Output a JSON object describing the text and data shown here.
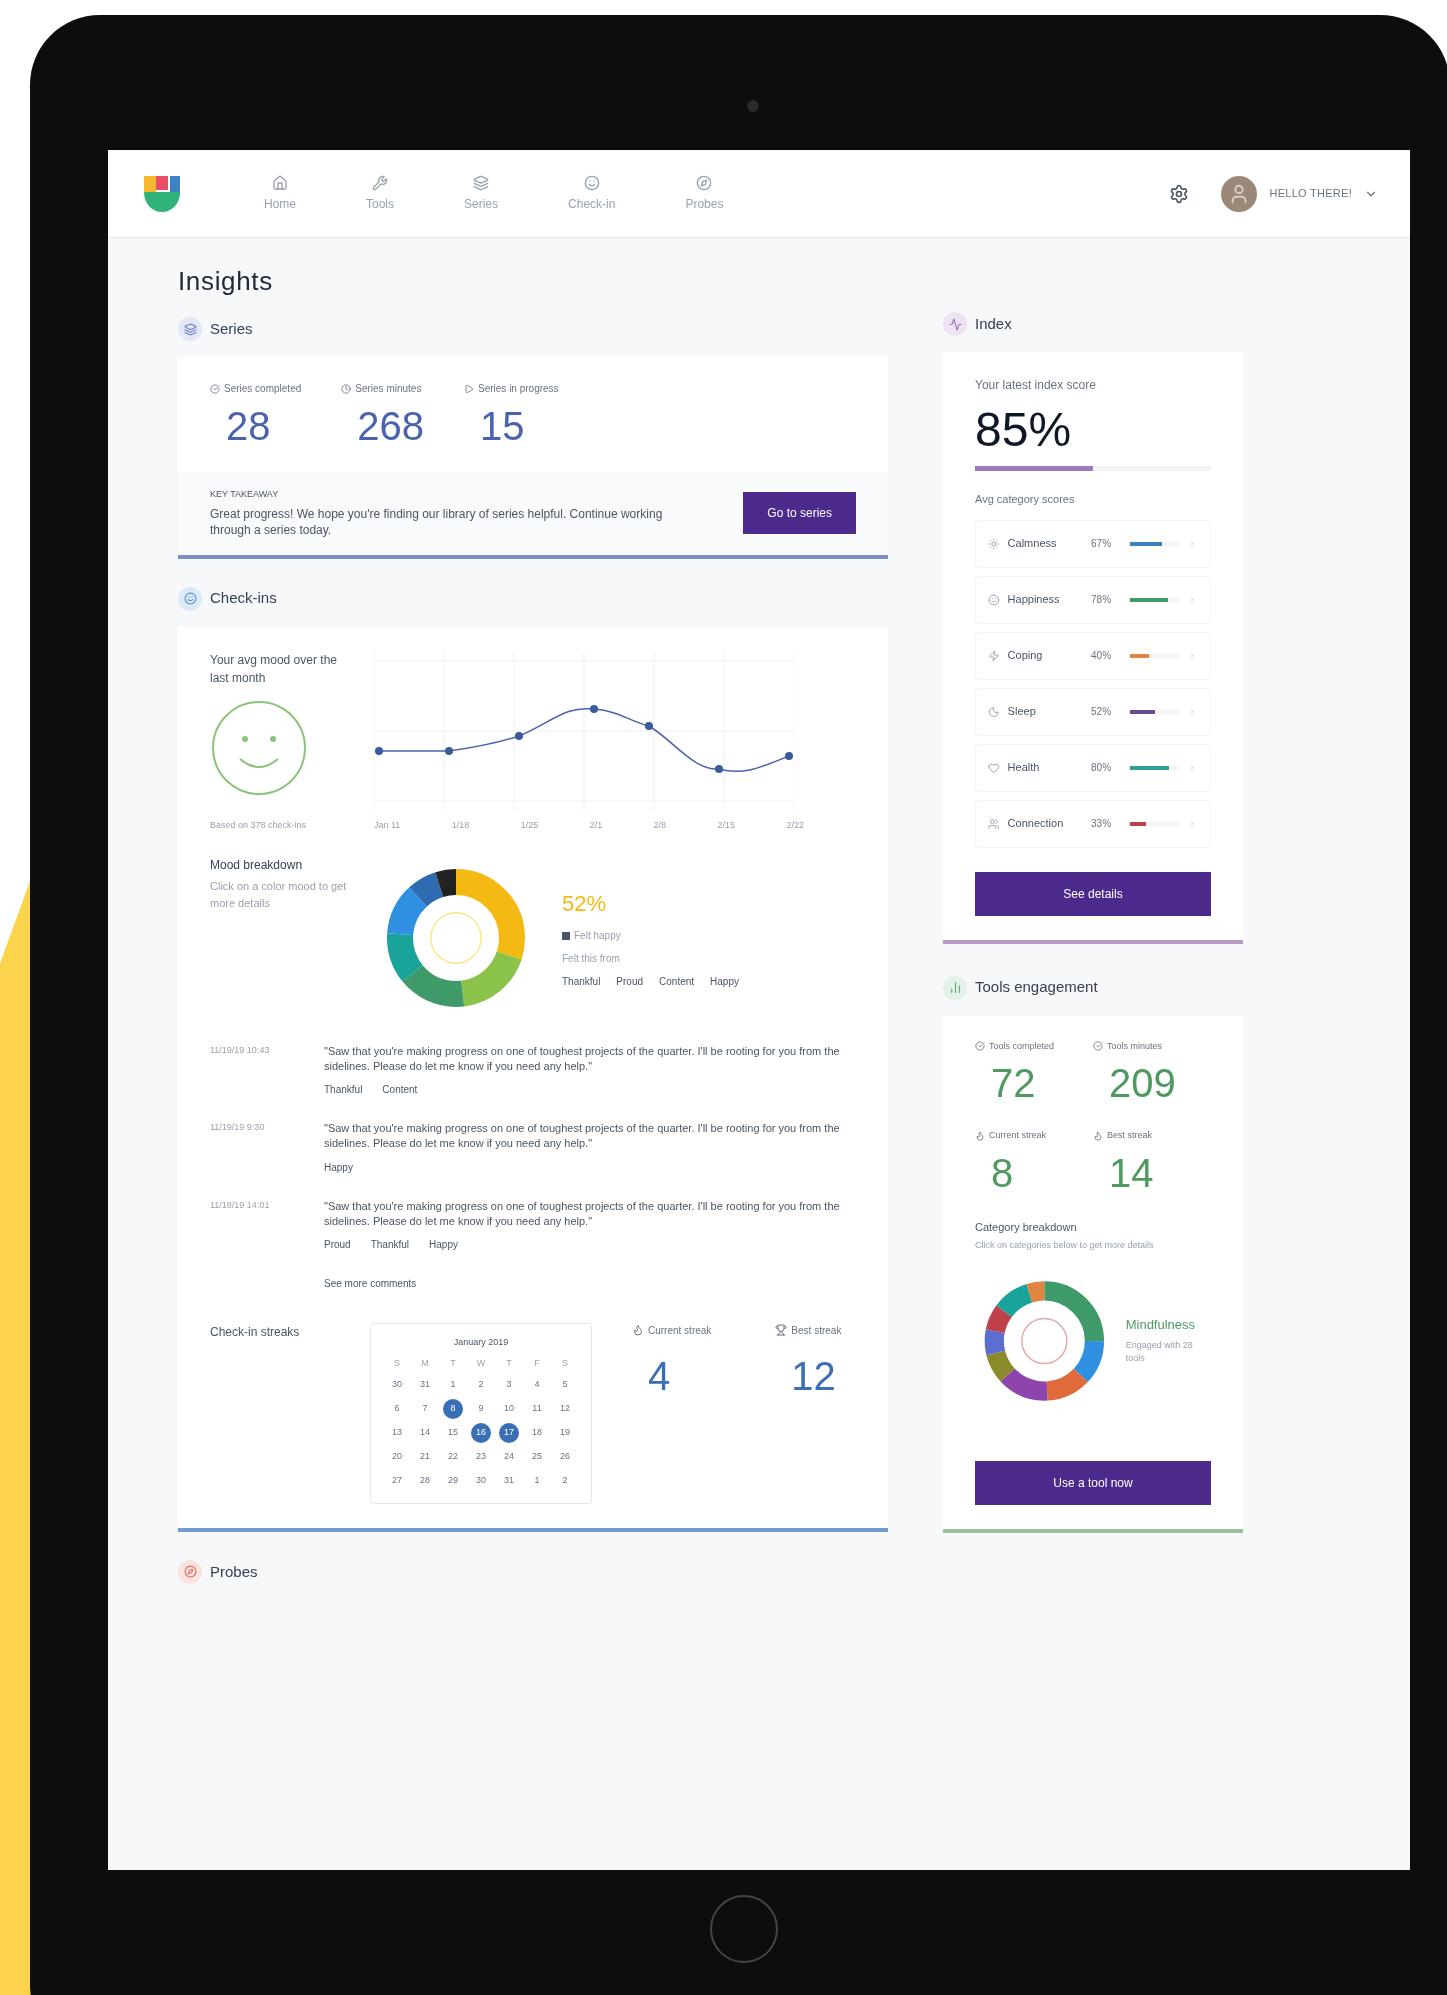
{
  "nav": {
    "items": [
      {
        "label": "Home",
        "selected": false
      },
      {
        "label": "Tools",
        "selected": false
      },
      {
        "label": "Series",
        "selected": false
      },
      {
        "label": "Check-in",
        "selected": false
      },
      {
        "label": "Probes",
        "selected": false
      }
    ],
    "user": "HELLO THERE!"
  },
  "page_title": "Insights",
  "series": {
    "title": "Series",
    "stats": [
      {
        "label": "Series completed",
        "value": "28"
      },
      {
        "label": "Series minutes",
        "value": "268"
      },
      {
        "label": "Series in progress",
        "value": "15"
      }
    ],
    "takeaway_label": "KEY TAKEAWAY",
    "takeaway": "Great progress! We hope you're finding our library of series helpful. Continue working through a series today.",
    "button": "Go to series"
  },
  "checkins": {
    "title": "Check-ins",
    "avg_mood": "Your avg mood over the last month",
    "based_on": "Based on 378 check-ins",
    "x_labels": [
      "Jan 11",
      "1/18",
      "1/25",
      "2/1",
      "2/8",
      "2/15",
      "2/22"
    ],
    "breakdown_title": "Mood breakdown",
    "breakdown_hint": "Click on a color mood to get more details",
    "percent": "52%",
    "felt": "Felt happy",
    "felt_from": "Felt this from",
    "moods": [
      "Thankful",
      "Proud",
      "Content",
      "Happy"
    ],
    "comments": [
      {
        "date": "11/19/19 10:43",
        "text": "\"Saw that you're making progress on one of toughest projects of the quarter. I'll be rooting for you from the sidelines. Please do let me know if you need any help.\"",
        "tags": [
          "Thankful",
          "Content"
        ]
      },
      {
        "date": "11/19/19 9:30",
        "text": "\"Saw that you're making progress on one of toughest projects of the quarter. I'll be rooting for you from the sidelines. Please do let me know if you need any help.\"",
        "tags": [
          "Happy"
        ]
      },
      {
        "date": "11/18/19 14:01",
        "text": "\"Saw that you're making progress on one of toughest projects of the quarter. I'll be rooting for you from the sidelines. Please do let me know if you need any help.\"",
        "tags": [
          "Proud",
          "Thankful",
          "Happy"
        ]
      }
    ],
    "more": "See more comments",
    "streaks_title": "Check-in streaks",
    "calendar": {
      "month": "January 2019",
      "weekdays": [
        "S",
        "M",
        "T",
        "W",
        "T",
        "F",
        "S"
      ],
      "weeks": [
        [
          {
            "d": "30",
            "selected": false
          },
          {
            "d": "31",
            "selected": false
          },
          {
            "d": "1",
            "selected": false
          },
          {
            "d": "2",
            "selected": false
          },
          {
            "d": "3",
            "selected": false
          },
          {
            "d": "4",
            "selected": false
          },
          {
            "d": "5",
            "selected": false
          }
        ],
        [
          {
            "d": "6",
            "selected": false
          },
          {
            "d": "7",
            "selected": false
          },
          {
            "d": "8",
            "selected": true
          },
          {
            "d": "9",
            "selected": false
          },
          {
            "d": "10",
            "selected": false
          },
          {
            "d": "11",
            "selected": false
          },
          {
            "d": "12",
            "selected": false
          }
        ],
        [
          {
            "d": "13",
            "selected": false
          },
          {
            "d": "14",
            "selected": false
          },
          {
            "d": "15",
            "selected": false
          },
          {
            "d": "16",
            "selected": true
          },
          {
            "d": "17",
            "selected": true
          },
          {
            "d": "18",
            "selected": false
          },
          {
            "d": "19",
            "selected": false
          }
        ],
        [
          {
            "d": "20",
            "selected": false
          },
          {
            "d": "21",
            "selected": false
          },
          {
            "d": "22",
            "selected": false
          },
          {
            "d": "23",
            "selected": false
          },
          {
            "d": "24",
            "selected": false
          },
          {
            "d": "25",
            "selected": false
          },
          {
            "d": "26",
            "selected": false
          }
        ],
        [
          {
            "d": "27",
            "selected": false
          },
          {
            "d": "28",
            "selected": false
          },
          {
            "d": "29",
            "selected": false
          },
          {
            "d": "30",
            "selected": false
          },
          {
            "d": "31",
            "selected": false
          },
          {
            "d": "1",
            "selected": false
          },
          {
            "d": "2",
            "selected": false
          }
        ]
      ]
    },
    "streaks": [
      {
        "label": "Current streak",
        "value": "4"
      },
      {
        "label": "Best streak",
        "value": "12"
      }
    ]
  },
  "probes": {
    "title": "Probes"
  },
  "index": {
    "title": "Index",
    "score_label": "Your latest index score",
    "score": "85%",
    "level": 0.5,
    "avg_label": "Avg category scores",
    "categories": [
      {
        "name": "Calmness",
        "reading": "67%",
        "level": 0.67,
        "color": "#3b82c4"
      },
      {
        "name": "Happiness",
        "reading": "78%",
        "level": 0.78,
        "color": "#3f9a6a"
      },
      {
        "name": "Coping",
        "reading": "40%",
        "level": 0.4,
        "color": "#e0853f"
      },
      {
        "name": "Sleep",
        "reading": "52%",
        "level": 0.52,
        "color": "#6b4a8f"
      },
      {
        "name": "Health",
        "reading": "80%",
        "level": 0.8,
        "color": "#2ba394"
      },
      {
        "name": "Connection",
        "reading": "33%",
        "level": 0.33,
        "color": "#c0404a"
      }
    ],
    "button": "See details"
  },
  "tools": {
    "title": "Tools engagement",
    "stats": [
      {
        "label": "Tools completed",
        "value": "72"
      },
      {
        "label": "Tools minutes",
        "value": "209"
      },
      {
        "label": "Current streak",
        "value": "8"
      },
      {
        "label": "Best streak",
        "value": "14"
      }
    ],
    "breakdown_title": "Category breakdown",
    "breakdown_hint": "Click on categories below to get more details",
    "category": "Mindfulness",
    "engaged": "Engaged with 28 tools",
    "button": "Use a tool now"
  }
}
